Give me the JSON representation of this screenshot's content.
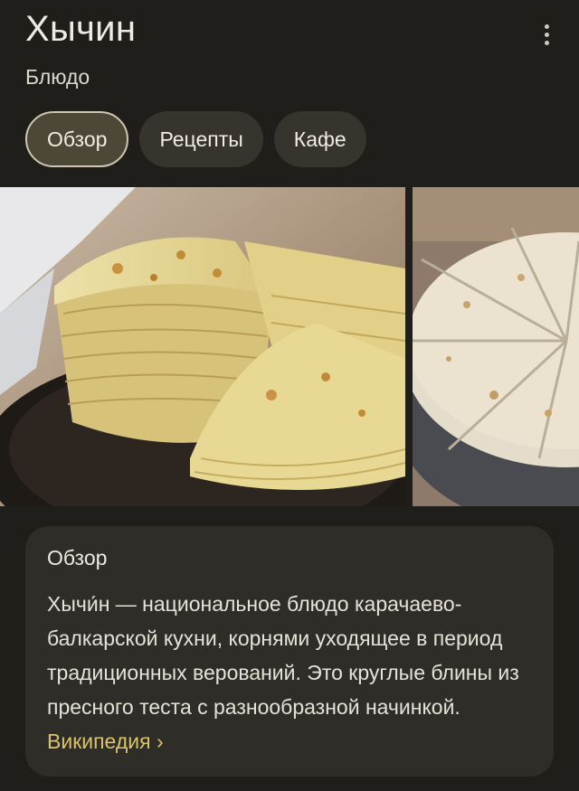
{
  "header": {
    "title": "Хычин",
    "subtitle": "Блюдо",
    "more_icon": "more-vert-icon"
  },
  "tabs": [
    {
      "label": "Обзор",
      "active": true
    },
    {
      "label": "Рецепты",
      "active": false
    },
    {
      "label": "Кафе",
      "active": false
    }
  ],
  "overview": {
    "title": "Обзор",
    "text": "Хычи́н — национальное блюдо карачаево-балкарской кухни, корнями уходящее в период традиционных верований. Это круглые блины из пресного теста с разнообразной начинкой.",
    "source_link": "Википедия",
    "source_chevron": "›"
  },
  "colors": {
    "background": "#1f1e1b",
    "chip": "#36342c",
    "chip_active": "#4c4737",
    "card": "#2f2d27",
    "link": "#d9c36b"
  }
}
